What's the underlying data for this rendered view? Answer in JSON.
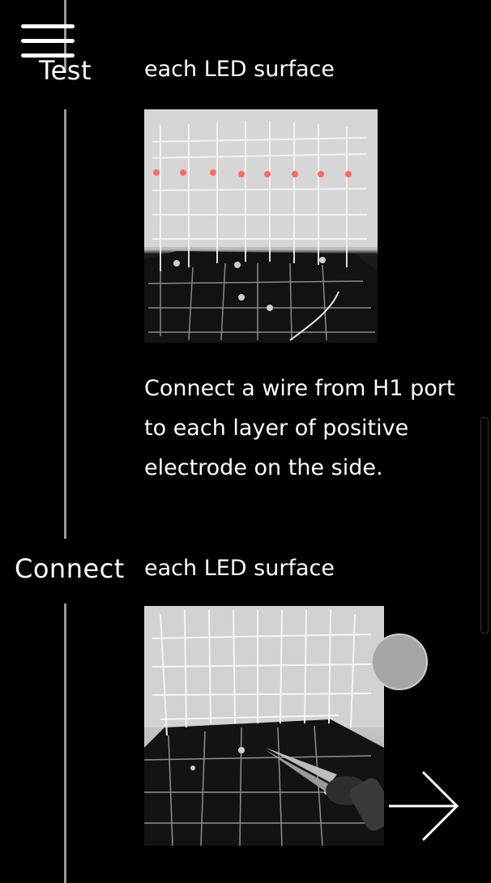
{
  "steps": [
    {
      "label": "Test",
      "subtitle": "each LED surface",
      "image_alt": "LED cube with a lit red layer on a circuit board",
      "description": "Connect a wire from H1 port to each layer of positive electrode on the side."
    },
    {
      "label": "Connect",
      "subtitle": "each LED surface",
      "image_alt": "LED cube wire grid on a circuit board being soldered with pliers"
    }
  ],
  "icons": {
    "menu": "hamburger-menu-icon",
    "next": "arrow-right-icon",
    "scroll_handle": "circle-handle"
  },
  "colors": {
    "background": "#000000",
    "text": "#ffffff",
    "timeline": "#9a9a9a",
    "led_lit": "#ff6a5a"
  }
}
